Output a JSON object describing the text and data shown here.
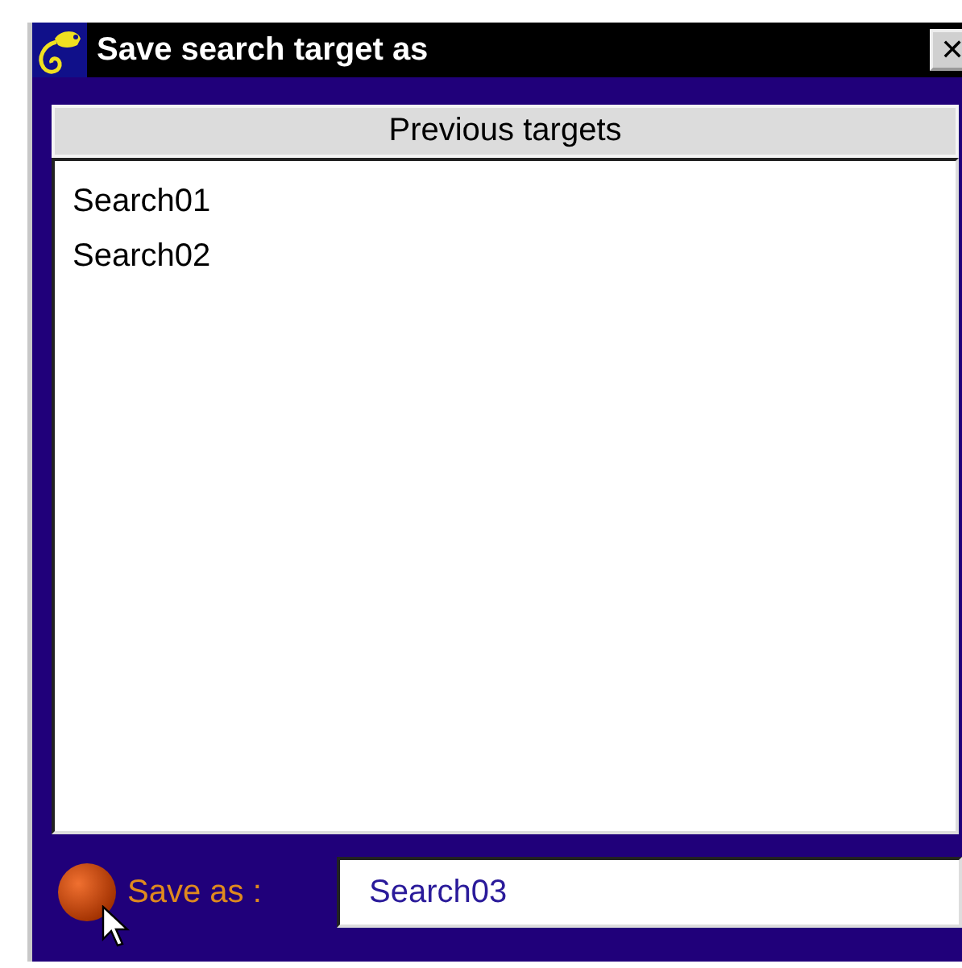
{
  "window": {
    "title": "Save search target as",
    "close": "✕"
  },
  "list": {
    "header": "Previous targets",
    "items": [
      {
        "label": "Search01",
        "selected": false
      },
      {
        "label": "Search02",
        "selected": false
      }
    ]
  },
  "save_as": {
    "label": "Save as :",
    "value": "Search03"
  }
}
